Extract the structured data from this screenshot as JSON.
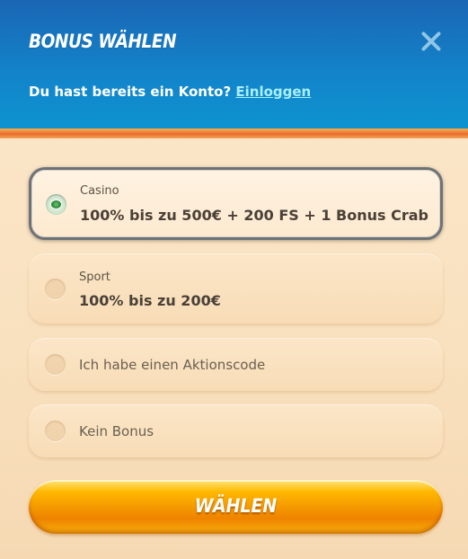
{
  "header": {
    "title": "BONUS WÄHLEN",
    "close_icon": "close-icon",
    "prompt": "Du hast bereits ein Konto?",
    "login_link": "Einloggen"
  },
  "options": [
    {
      "category": "Casino",
      "offer": "100% bis zu 500€ + 200 FS + 1 Bonus Crab",
      "selected": true
    },
    {
      "category": "Sport",
      "offer": "100% bis zu 200€",
      "selected": false
    },
    {
      "label": "Ich habe einen Aktionscode",
      "selected": false
    },
    {
      "label": "Kein Bonus",
      "selected": false
    }
  ],
  "cta": {
    "label": "WÄHLEN"
  },
  "colors": {
    "header_top": "#1a66b4",
    "header_bottom": "#0d94d1",
    "accent_orange": "#ea6b2c",
    "link": "#a9f0ff",
    "panel_bg": "#fbe8cc",
    "cta_gold": "#f59a00",
    "radio_selected": "#2d8a3a"
  }
}
